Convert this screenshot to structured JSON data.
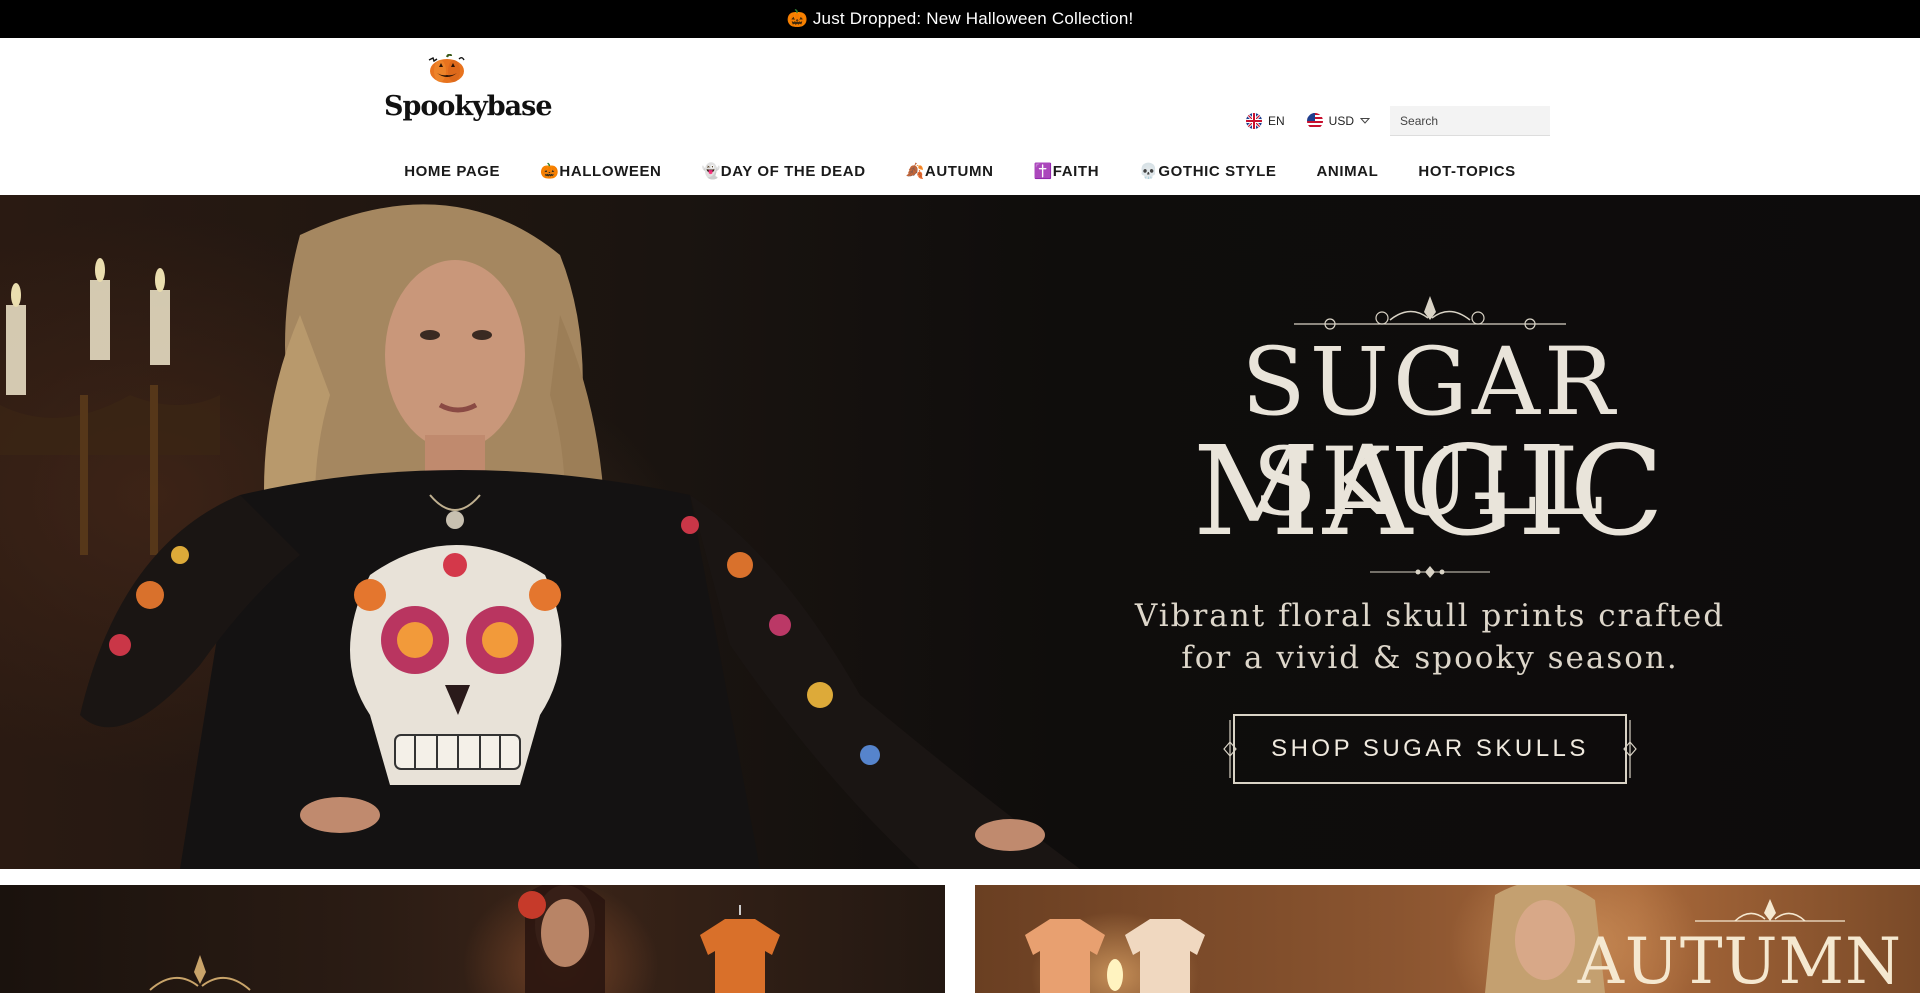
{
  "announcement": {
    "text": "🎃 Just Dropped: New Halloween Collection!"
  },
  "header": {
    "logo_text": "Spookybase",
    "language": "EN",
    "currency": "USD",
    "search_placeholder": "Search"
  },
  "nav": {
    "items": [
      {
        "label": "HOME PAGE"
      },
      {
        "label": "🎃HALLOWEEN"
      },
      {
        "label": "👻DAY OF THE DEAD"
      },
      {
        "label": "🍂AUTUMN"
      },
      {
        "label": "✝️FAITH"
      },
      {
        "label": "💀GOTHIC STYLE"
      },
      {
        "label": "ANIMAL"
      },
      {
        "label": "HOT-TOPICS"
      }
    ]
  },
  "hero": {
    "title_line1": "SUGAR SKULL",
    "title_line2": "MAGIC",
    "subtitle_line1": "Vibrant floral skull prints crafted",
    "subtitle_line2": "for a vivid & spooky season.",
    "cta_label": "SHOP SUGAR SKULLS"
  },
  "cards": {
    "right_title": "AUTUMN"
  },
  "colors": {
    "announcement_bg": "#000000",
    "hero_text": "#e9e4da",
    "accent_pumpkin": "#e8731e"
  }
}
